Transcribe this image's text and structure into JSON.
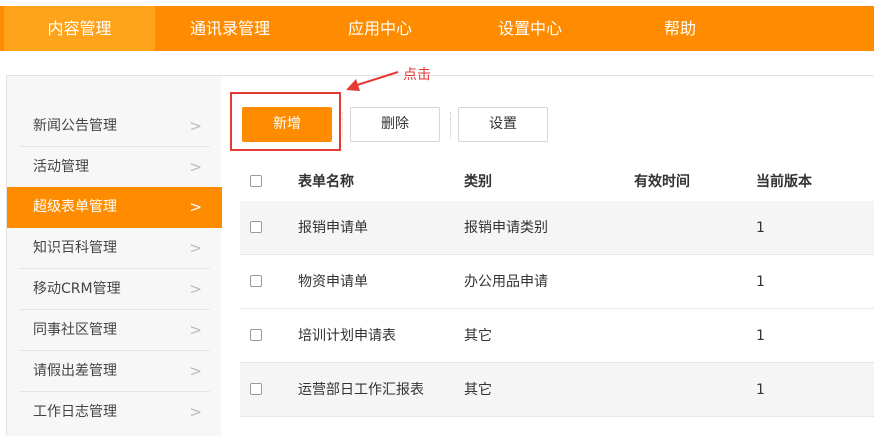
{
  "nav": {
    "items": [
      "内容管理",
      "通讯录管理",
      "应用中心",
      "设置中心",
      "帮助"
    ],
    "active_index": 0
  },
  "sidebar": {
    "items": [
      "新闻公告管理",
      "活动管理",
      "超级表单管理",
      "知识百科管理",
      "移动CRM管理",
      "同事社区管理",
      "请假出差管理",
      "工作日志管理"
    ],
    "active_index": 2,
    "chevron": ">"
  },
  "toolbar": {
    "add_label": "新增",
    "delete_label": "删除",
    "settings_label": "设置"
  },
  "annotation": {
    "hint": "点击"
  },
  "table": {
    "columns": [
      "表单名称",
      "类别",
      "有效时间",
      "当前版本"
    ],
    "rows": [
      {
        "name": "报销申请单",
        "category": "报销申请类别",
        "valid_time": "",
        "version": "1"
      },
      {
        "name": "物资申请单",
        "category": "办公用品申请",
        "valid_time": "",
        "version": "1"
      },
      {
        "name": "培训计划申请表",
        "category": "其它",
        "valid_time": "",
        "version": "1"
      },
      {
        "name": "运营部日工作汇报表",
        "category": "其它",
        "valid_time": "",
        "version": "1"
      }
    ]
  },
  "colors": {
    "brand": "#ff8c00",
    "brand_light": "#ffa31a",
    "annotation": "#e53935"
  }
}
